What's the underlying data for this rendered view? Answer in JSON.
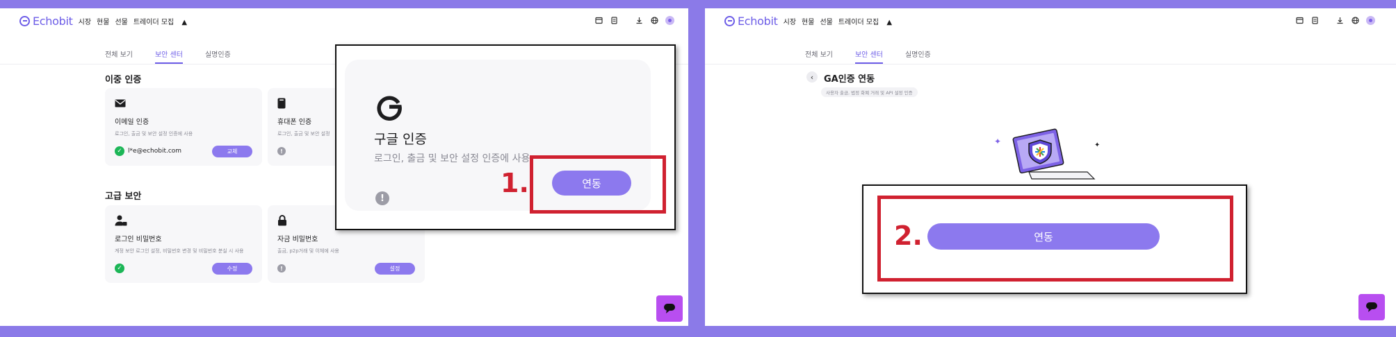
{
  "nav": {
    "brand": "Echobit",
    "links": [
      "시장",
      "현물",
      "선물",
      "트레이더 모집"
    ]
  },
  "tabs": [
    "전체 보기",
    "보안 센터",
    "실명인증"
  ],
  "left": {
    "two_factor_title": "이중 인증",
    "advanced_title": "고급 보안",
    "cards": {
      "email": {
        "title": "이메일 인증",
        "desc": "로그인, 출금 및 보안 설정 인증에 사용",
        "value": "l*e@echobit.com",
        "button": "교체"
      },
      "phone": {
        "title": "휴대폰 인증",
        "desc": "로그인, 출금 및 보안 설정"
      },
      "login_pw": {
        "title": "로그인 비밀번호",
        "desc": "계정 보안 로그인 설정, 비밀번호 변경 및 비밀번호 분실 시 사용",
        "button": "수정"
      },
      "fund_pw": {
        "title": "자금 비밀번호",
        "desc": "출금, p2p거래 및 이체에 사용",
        "button": "설정"
      }
    }
  },
  "zoom1": {
    "title": "구글 인증",
    "desc": "로그인, 출금 및 보안 설정 인증에 사용",
    "button": "연동",
    "step": "1."
  },
  "right": {
    "title": "GA인증 연동",
    "chip": "사용자 출금, 법정 화폐 거래 및 API 설정 인증"
  },
  "zoom2": {
    "button": "연동",
    "step": "2."
  },
  "colors": {
    "frame": "#8b7ae8",
    "accent": "#6c5ce7",
    "button": "#8c79ee",
    "annotation_red": "#d02130",
    "chat": "#b84ef0"
  }
}
